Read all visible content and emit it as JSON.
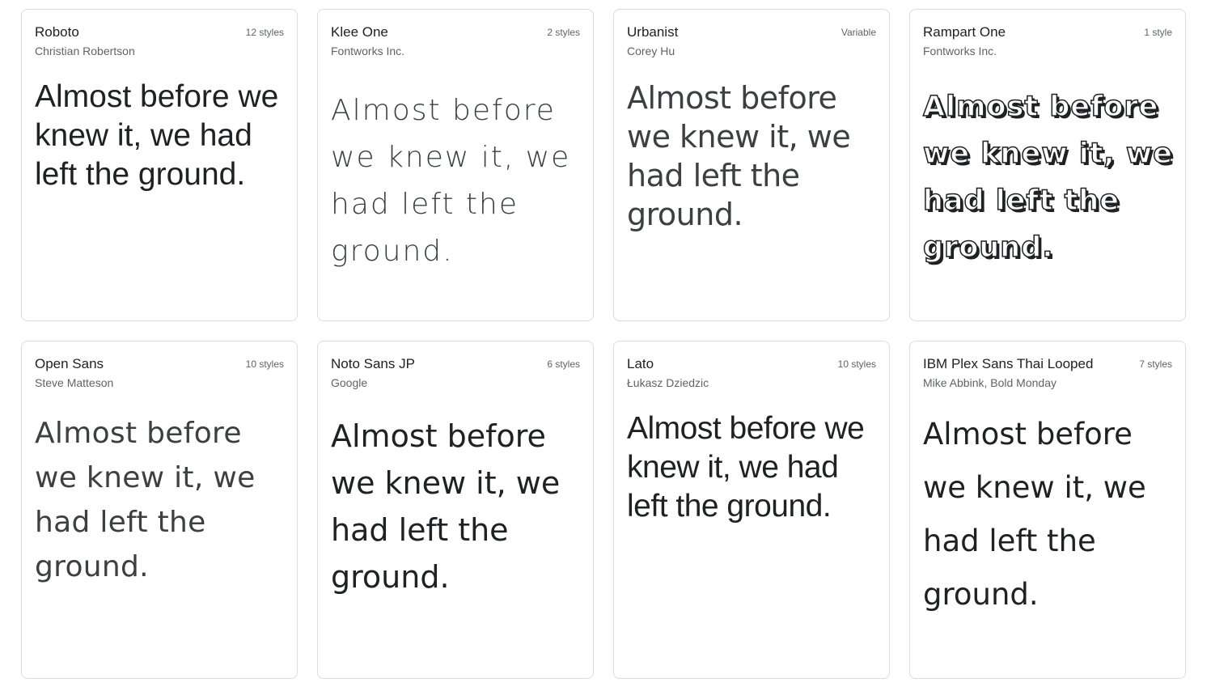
{
  "sample_text": "Almost before we knew it, we had left the ground.",
  "fonts": [
    {
      "name": "Roboto",
      "styles": "12 styles",
      "designer": "Christian Robertson"
    },
    {
      "name": "Klee One",
      "styles": "2 styles",
      "designer": "Fontworks Inc."
    },
    {
      "name": "Urbanist",
      "styles": "Variable",
      "designer": "Corey Hu"
    },
    {
      "name": "Rampart One",
      "styles": "1 style",
      "designer": "Fontworks Inc."
    },
    {
      "name": "Open Sans",
      "styles": "10 styles",
      "designer": "Steve Matteson"
    },
    {
      "name": "Noto Sans JP",
      "styles": "6 styles",
      "designer": "Google"
    },
    {
      "name": "Lato",
      "styles": "10 styles",
      "designer": "Łukasz Dziedzic"
    },
    {
      "name": "IBM Plex Sans Thai Looped",
      "styles": "7 styles",
      "designer": "Mike Abbink, Bold Monday"
    }
  ]
}
